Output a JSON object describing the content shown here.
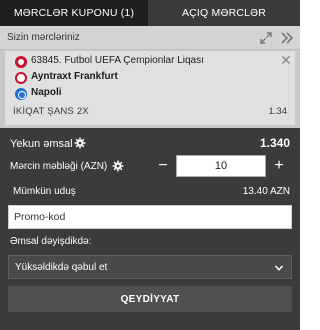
{
  "tabs": {
    "active_label": "MƏRCLƏR KUPONU (1)",
    "inactive_label": "AÇIQ MƏRCLƏR"
  },
  "subheader": {
    "title": "Sizin mərcləriniz"
  },
  "bet": {
    "league": "63845. Futbol UEFA Çempionlar Liqası",
    "team1": "Ayntraxt Frankfurt",
    "team2": "Napoli",
    "market": "İKİQAT ŞANS 2X",
    "odds": "1.34",
    "close_symbol": "✕"
  },
  "summary": {
    "total_odds_label": "Yekun əmsal",
    "total_odds_value": "1.340",
    "stake_label": "Mərcin məbləği (AZN)",
    "stake_value": "10",
    "minus_label": "−",
    "plus_label": "+",
    "winnings_label": "Mümkün uduş",
    "winnings_value": "13.40 AZN"
  },
  "promo": {
    "placeholder": "Promo-kod"
  },
  "odds_change": {
    "label": "Əmsal dəyişdikdə:",
    "selected": "Yüksəldikdə qəbul et"
  },
  "submit": {
    "label": "QEYDİYYAT"
  },
  "colors": {
    "tab_active": "#1e1e1e",
    "tab_inactive": "#3c3c3c",
    "panel": "#3b3b3b",
    "card": "#e0e0e0",
    "league_red": "#c8102e",
    "napoli_blue": "#1f6fd1"
  },
  "icons": {
    "expand": "expand-arrows-icon",
    "collapse": "double-chevron-right-icon",
    "settings": "gear-icon",
    "dropdown": "chevron-down-icon",
    "close": "close-icon"
  }
}
